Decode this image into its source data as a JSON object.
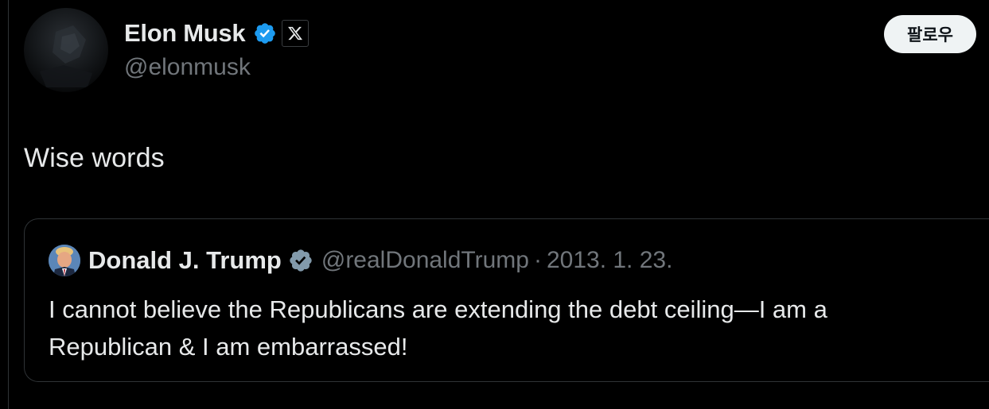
{
  "tweet": {
    "author": {
      "display_name": "Elon Musk",
      "handle": "@elonmusk",
      "verified_icon": "verified-badge-icon",
      "affiliation_icon": "x-logo-icon"
    },
    "follow_label": "팔로우",
    "text": "Wise words"
  },
  "quote": {
    "author": {
      "display_name": "Donald J. Trump",
      "handle": "@realDonaldTrump",
      "verified_icon": "verified-badge-icon"
    },
    "separator": "·",
    "date": "2013. 1. 23.",
    "text": "I cannot believe the Republicans are extending the debt ceiling—I am a Republican & I am embarrassed!"
  },
  "colors": {
    "background": "#000000",
    "primary_text": "#e7e9ea",
    "secondary_text": "#71767b",
    "verified_blue": "#1d9bf0",
    "verified_gray": "#829aab",
    "border": "#2f3336",
    "follow_bg": "#eff3f4"
  }
}
